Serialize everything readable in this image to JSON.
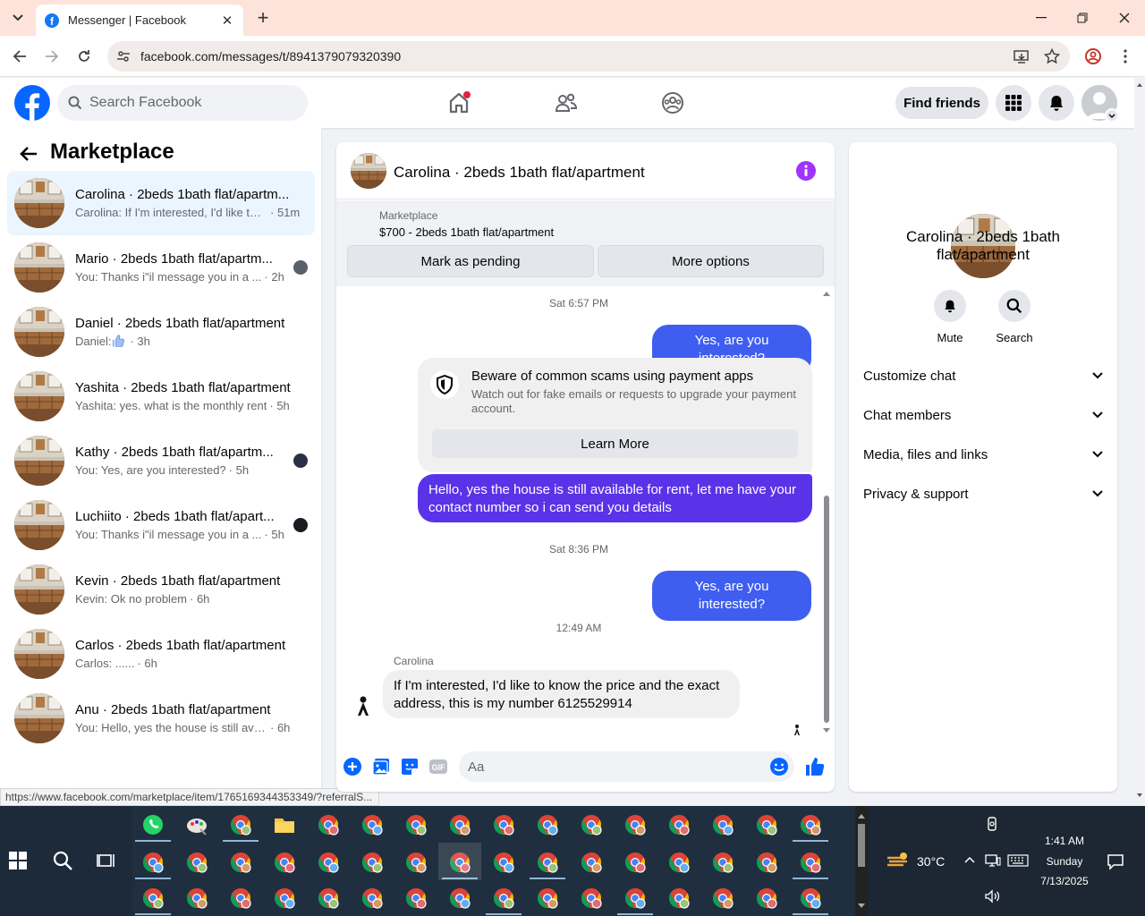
{
  "browser": {
    "tab_title": "Messenger | Facebook",
    "url": "facebook.com/messages/t/8941379079320390",
    "status_url": "https://www.facebook.com/marketplace/item/1765169344353349/?referralS..."
  },
  "header": {
    "search_placeholder": "Search Facebook",
    "find_friends": "Find friends"
  },
  "sidebar": {
    "title": "Marketplace",
    "conversations": [
      {
        "name": "Carolina · 2beds 1bath flat/apartm...",
        "preview": "Carolina: If I'm interested, I'd like to ...",
        "time": "· 51m",
        "active": true
      },
      {
        "name": "Mario · 2beds 1bath flat/apartm...",
        "preview": "You: Thanks i\"il message you in a ...",
        "time": "· 2h"
      },
      {
        "name": "Daniel · 2beds 1bath flat/apartment",
        "preview": "Daniel: ",
        "time": "· 3h"
      },
      {
        "name": "Yashita · 2beds 1bath flat/apartment",
        "preview": "Yashita: yes. what is the monthly rent",
        "time": "· 5h"
      },
      {
        "name": "Kathy · 2beds 1bath flat/apartm...",
        "preview": "You: Yes, are you interested?",
        "time": "· 5h"
      },
      {
        "name": "Luchiito · 2beds 1bath flat/apart...",
        "preview": "You: Thanks i\"il message you in a ...",
        "time": "· 5h"
      },
      {
        "name": "Kevin · 2beds 1bath flat/apartment",
        "preview": "Kevin: Ok no problem",
        "time": "· 6h"
      },
      {
        "name": "Carlos · 2beds 1bath flat/apartment",
        "preview": "Carlos: ......",
        "time": "· 6h"
      },
      {
        "name": "Anu · 2beds 1bath flat/apartment",
        "preview": "You: Hello, yes the house is still availa...",
        "time": "· 6h"
      }
    ]
  },
  "chat": {
    "title": "Carolina · 2beds 1bath flat/apartment",
    "marketplace_label": "Marketplace",
    "listing": "$700 - 2beds 1bath flat/apartment",
    "mark_pending": "Mark as pending",
    "more_options": "More options",
    "ts1": "Sat 6:57 PM",
    "msg1": "Yes, are you interested?",
    "scam_title": "Beware of common scams using payment apps",
    "scam_text": "Watch out for fake emails or requests to upgrade your payment account.",
    "learn_more": "Learn More",
    "msg2": "Hello, yes the house is still available for rent, let me have your contact number so i can send you details",
    "ts2": "Sat 8:36 PM",
    "msg3": "Yes, are you interested?",
    "ts3": "12:49 AM",
    "sender": "Carolina",
    "msg4": "If I'm interested, I'd like to know the price and the exact address, this is my number 6125529914",
    "composer_placeholder": "Aa",
    "gif": "GIF"
  },
  "info": {
    "name": "Carolina · 2beds 1bath flat/apartment",
    "mute": "Mute",
    "search": "Search",
    "sections": [
      "Customize chat",
      "Chat members",
      "Media, files and links",
      "Privacy & support"
    ]
  },
  "taskbar": {
    "temp": "30°C",
    "time": "1:41 AM",
    "day": "Sunday",
    "date": "7/13/2025"
  },
  "colors": {
    "fb_blue": "#0866ff",
    "bubble_purple": "#5a33e8",
    "bubble_blue": "#3f5ef0",
    "info_purple": "#a033ff",
    "tab_strip": "#fde3da"
  }
}
